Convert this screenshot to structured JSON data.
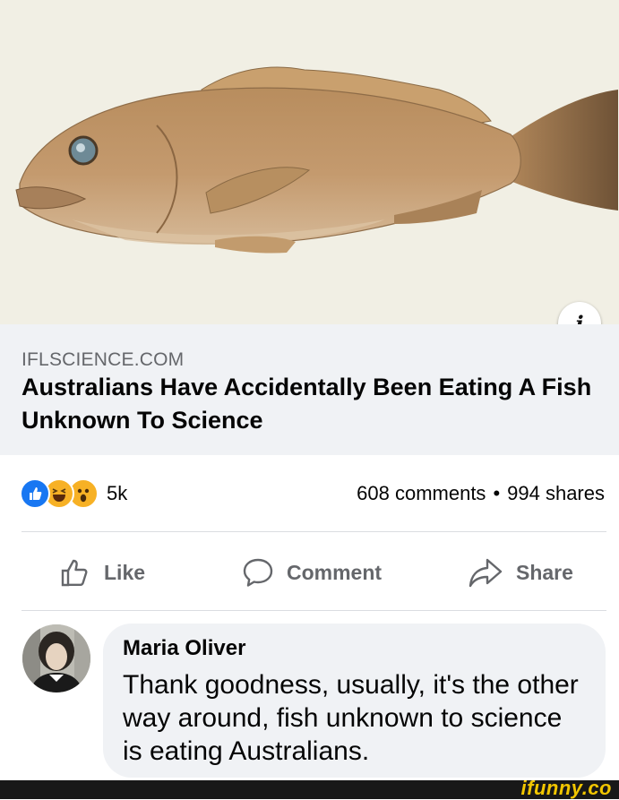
{
  "link": {
    "domain": "IFLSCIENCE.COM",
    "headline": "Australians Have Accidentally Been Eating A Fish Unknown To Science"
  },
  "reactions": {
    "icons": [
      "like-icon",
      "haha-icon",
      "wow-icon"
    ],
    "count": "5k"
  },
  "stats": {
    "comments": "608 comments",
    "separator": "•",
    "shares": "994 shares"
  },
  "actions": {
    "like": "Like",
    "comment": "Comment",
    "share": "Share"
  },
  "comment": {
    "author": "Maria Oliver",
    "text": "Thank goodness, usually, it's the other way around, fish unknown to science is eating Australians."
  },
  "watermark": "ifunny.co",
  "colors": {
    "accent_blue": "#1877f2",
    "reaction_yellow": "#f7b125",
    "muted_text": "#65676b",
    "link_box_bg": "#f0f2f5"
  }
}
